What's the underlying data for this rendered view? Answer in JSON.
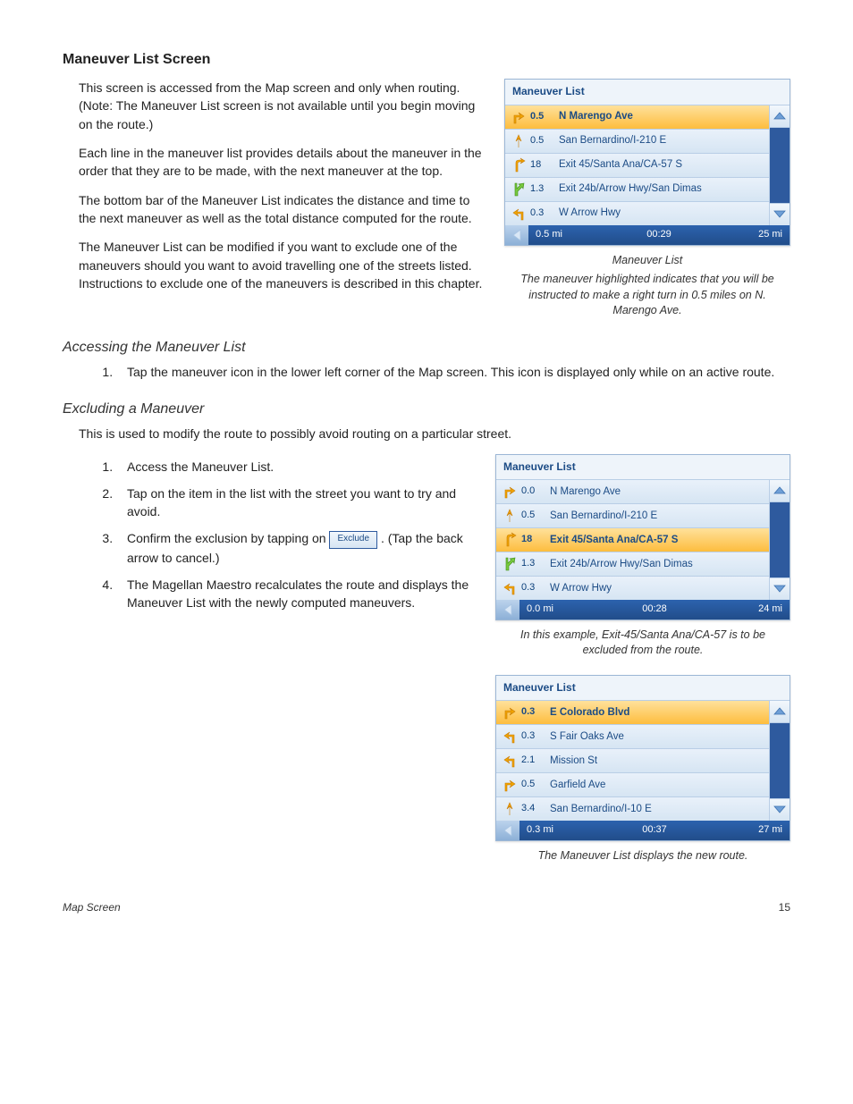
{
  "section_title": "Maneuver List Screen",
  "para1": "This screen is accessed from the Map screen and only when routing.  (Note:  The Maneuver List screen is not available until you begin moving on the route.)",
  "para2": "Each line in the maneuver list provides details about the maneuver in the order that they are to be made, with the next maneuver at the top.",
  "para3": "The bottom bar of the Maneuver List indicates the distance and time to the next maneuver as well as the total distance computed for the route.",
  "para4": "The Maneuver List can be modified if you want to exclude one of the maneuvers should you want to avoid travelling one of the streets listed.  Instructions to exclude one of the maneuvers is described in this chapter.",
  "sub1_title": "Accessing the Maneuver List",
  "sub1_step1": "Tap the maneuver icon in the lower left corner of the Map screen.  This icon is displayed only while on an active route.",
  "sub2_title": "Excluding a Maneuver",
  "sub2_intro": "This is used to modify the route to possibly avoid routing on a particular street.",
  "sub2_step1": "Access the Maneuver List.",
  "sub2_step2": "Tap on the item in the list with the street you want to try and avoid.",
  "sub2_step3_a": "Confirm the exclusion by tapping on ",
  "sub2_step3_b": ".  (Tap the back arrow to cancel.)",
  "exclude_label": "Exclude",
  "sub2_step4": "The Magellan Maestro recalculates the route and displays the Maneuver List with the newly computed maneuvers.",
  "ml_header": "Maneuver List",
  "ml1": {
    "rows": [
      {
        "dist": "0.5",
        "name": "N Marengo Ave",
        "icon": "turn-right",
        "hl": true
      },
      {
        "dist": "0.5",
        "name": "San Bernardino/I-210 E",
        "icon": "merge-up"
      },
      {
        "dist": "18",
        "name": "Exit 45/Santa Ana/CA-57 S",
        "icon": "fwy-right"
      },
      {
        "dist": "1.3",
        "name": "Exit 24b/Arrow Hwy/San Dimas",
        "icon": "exit-right"
      },
      {
        "dist": "0.3",
        "name": "W Arrow Hwy",
        "icon": "turn-left"
      }
    ],
    "footer": {
      "dist": "0.5 mi",
      "time": "00:29",
      "total": "25 mi"
    },
    "caption_title": "Maneuver List",
    "caption_sub": "The maneuver highlighted indicates that you will be instructed to  make a right turn in 0.5 miles on N. Marengo Ave."
  },
  "ml2": {
    "rows": [
      {
        "dist": "0.0",
        "name": "N Marengo Ave",
        "icon": "turn-right"
      },
      {
        "dist": "0.5",
        "name": "San Bernardino/I-210 E",
        "icon": "merge-up"
      },
      {
        "dist": "18",
        "name": "Exit 45/Santa Ana/CA-57 S",
        "icon": "fwy-right",
        "hl": true
      },
      {
        "dist": "1.3",
        "name": "Exit 24b/Arrow Hwy/San Dimas",
        "icon": "exit-right"
      },
      {
        "dist": "0.3",
        "name": "W Arrow Hwy",
        "icon": "turn-left"
      }
    ],
    "footer": {
      "dist": "0.0 mi",
      "time": "00:28",
      "total": "24 mi"
    },
    "caption_sub": "In this example, Exit-45/Santa Ana/CA-57 is to be excluded from the route."
  },
  "ml3": {
    "rows": [
      {
        "dist": "0.3",
        "name": "E Colorado Blvd",
        "icon": "turn-right",
        "hl": true
      },
      {
        "dist": "0.3",
        "name": "S Fair Oaks Ave",
        "icon": "turn-left"
      },
      {
        "dist": "2.1",
        "name": "Mission St",
        "icon": "turn-left"
      },
      {
        "dist": "0.5",
        "name": "Garfield Ave",
        "icon": "turn-right"
      },
      {
        "dist": "3.4",
        "name": "San Bernardino/I-10 E",
        "icon": "merge-up"
      }
    ],
    "footer": {
      "dist": "0.3 mi",
      "time": "00:37",
      "total": "27 mi"
    },
    "caption_sub": "The Maneuver List displays the new route."
  },
  "footer_section": "Map Screen",
  "footer_page": "15"
}
